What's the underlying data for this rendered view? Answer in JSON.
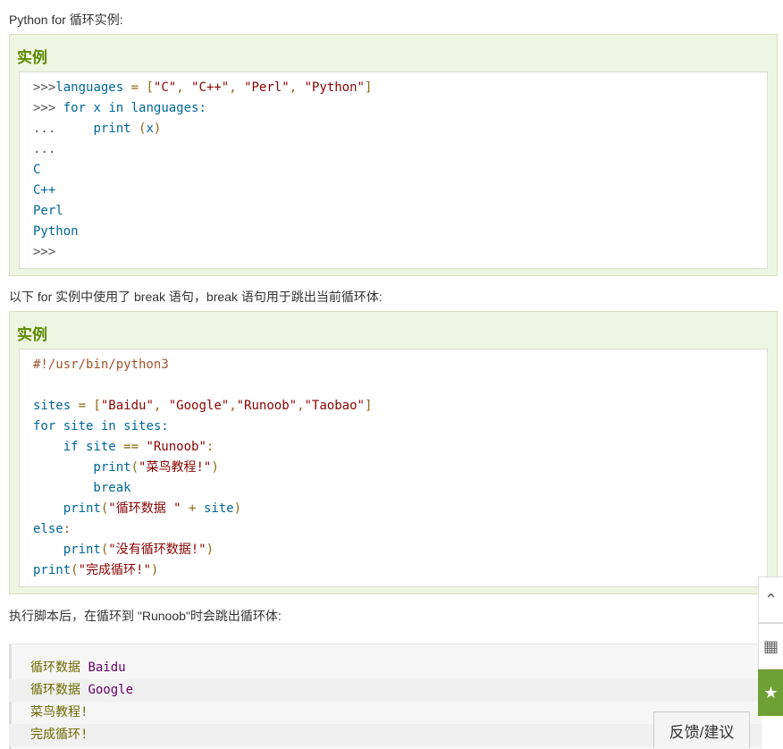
{
  "intro1": "Python for 循环实例:",
  "example1": {
    "title": "实例",
    "lines": [
      [
        {
          "c": "pr",
          "t": ">>>"
        },
        {
          "c": "pl",
          "t": "languages "
        },
        {
          "c": "punc",
          "t": "= ["
        },
        {
          "c": "str",
          "t": "\"C\""
        },
        {
          "c": "punc",
          "t": ", "
        },
        {
          "c": "str",
          "t": "\"C++\""
        },
        {
          "c": "punc",
          "t": ", "
        },
        {
          "c": "str",
          "t": "\"Perl\""
        },
        {
          "c": "punc",
          "t": ", "
        },
        {
          "c": "str",
          "t": "\"Python\""
        },
        {
          "c": "punc",
          "t": "]"
        }
      ],
      [
        {
          "c": "pr",
          "t": ">>> "
        },
        {
          "c": "kw",
          "t": "for"
        },
        {
          "c": "pl",
          "t": " x "
        },
        {
          "c": "kw",
          "t": "in"
        },
        {
          "c": "pl",
          "t": " languages:"
        }
      ],
      [
        {
          "c": "pr",
          "t": "...     "
        },
        {
          "c": "kw",
          "t": "print"
        },
        {
          "c": "punc",
          "t": " ("
        },
        {
          "c": "pl",
          "t": "x"
        },
        {
          "c": "punc",
          "t": ")"
        }
      ],
      [
        {
          "c": "pr",
          "t": "..."
        }
      ],
      [
        {
          "c": "out",
          "t": "C"
        }
      ],
      [
        {
          "c": "out",
          "t": "C++"
        }
      ],
      [
        {
          "c": "out",
          "t": "Perl"
        }
      ],
      [
        {
          "c": "out",
          "t": "Python"
        }
      ],
      [
        {
          "c": "pr",
          "t": ">>>"
        }
      ]
    ]
  },
  "intro2": "以下 for 实例中使用了 break 语句，break 语句用于跳出当前循环体:",
  "example2": {
    "title": "实例",
    "lines": [
      [
        {
          "c": "cm",
          "t": "#!/usr/bin/python3"
        }
      ],
      [
        {
          "c": "pl",
          "t": ""
        }
      ],
      [
        {
          "c": "pl",
          "t": "sites "
        },
        {
          "c": "punc",
          "t": "= ["
        },
        {
          "c": "str",
          "t": "\"Baidu\""
        },
        {
          "c": "punc",
          "t": ", "
        },
        {
          "c": "str",
          "t": "\"Google\""
        },
        {
          "c": "punc",
          "t": ","
        },
        {
          "c": "str",
          "t": "\"Runoob\""
        },
        {
          "c": "punc",
          "t": ","
        },
        {
          "c": "str",
          "t": "\"Taobao\""
        },
        {
          "c": "punc",
          "t": "]"
        }
      ],
      [
        {
          "c": "kw",
          "t": "for"
        },
        {
          "c": "pl",
          "t": " site "
        },
        {
          "c": "kw",
          "t": "in"
        },
        {
          "c": "pl",
          "t": " sites:"
        }
      ],
      [
        {
          "c": "pl",
          "t": "    "
        },
        {
          "c": "kw",
          "t": "if"
        },
        {
          "c": "pl",
          "t": " site "
        },
        {
          "c": "punc",
          "t": "== "
        },
        {
          "c": "str",
          "t": "\"Runoob\""
        },
        {
          "c": "punc",
          "t": ":"
        }
      ],
      [
        {
          "c": "pl",
          "t": "        print"
        },
        {
          "c": "punc",
          "t": "("
        },
        {
          "c": "str",
          "t": "\"菜鸟教程!\""
        },
        {
          "c": "punc",
          "t": ")"
        }
      ],
      [
        {
          "c": "kw",
          "t": "        break"
        }
      ],
      [
        {
          "c": "pl",
          "t": "    print"
        },
        {
          "c": "punc",
          "t": "("
        },
        {
          "c": "str",
          "t": "\"循环数据 \""
        },
        {
          "c": "punc",
          "t": " + "
        },
        {
          "c": "pl",
          "t": "site"
        },
        {
          "c": "punc",
          "t": ")"
        }
      ],
      [
        {
          "c": "kw",
          "t": "else"
        },
        {
          "c": "punc",
          "t": ":"
        }
      ],
      [
        {
          "c": "pl",
          "t": "    print"
        },
        {
          "c": "punc",
          "t": "("
        },
        {
          "c": "str",
          "t": "\"没有循环数据!\""
        },
        {
          "c": "punc",
          "t": ")"
        }
      ],
      [
        {
          "c": "pl",
          "t": "print"
        },
        {
          "c": "punc",
          "t": "("
        },
        {
          "c": "str",
          "t": "\"完成循环!\""
        },
        {
          "c": "punc",
          "t": ")"
        }
      ]
    ]
  },
  "intro3": "执行脚本后，在循环到 \"Runoob\"时会跳出循环体:",
  "output": [
    {
      "label": "循环数据 ",
      "value": "Baidu"
    },
    {
      "label": "循环数据 ",
      "value": "Google"
    },
    {
      "label": "菜鸟教程!",
      "value": ""
    },
    {
      "label": "完成循环!",
      "value": ""
    }
  ],
  "side_tools": [
    {
      "icon": "chevron-up-icon",
      "glyph": "⌃"
    },
    {
      "icon": "qrcode-icon",
      "glyph": "▦"
    },
    {
      "icon": "star-icon",
      "glyph": "★"
    }
  ],
  "feedback_label": "反馈/建议"
}
